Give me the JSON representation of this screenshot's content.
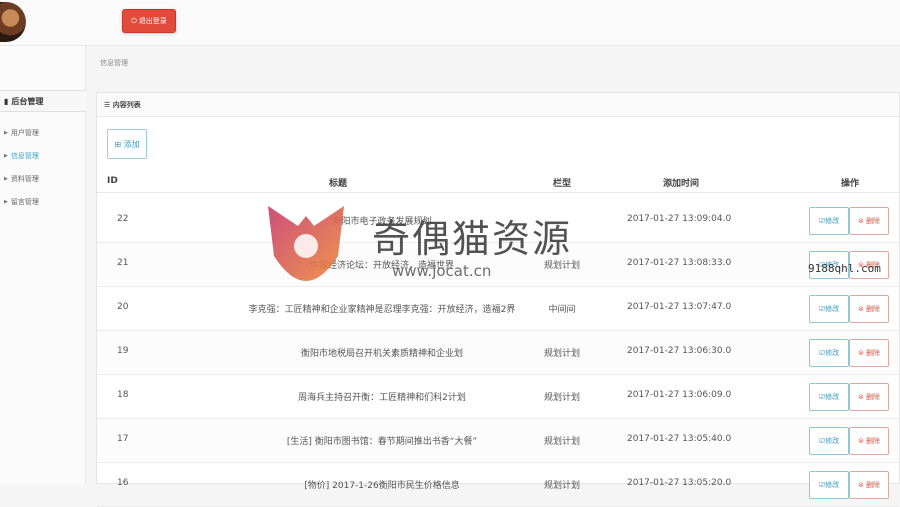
{
  "header": {
    "logout_label": "退出登录",
    "logout_icon": "power-icon"
  },
  "sidebar": {
    "title": "后台管理",
    "items": [
      {
        "label": "用户管理"
      },
      {
        "label": "信息管理",
        "active": true
      },
      {
        "label": "资料管理"
      },
      {
        "label": "留言管理"
      }
    ]
  },
  "breadcrumb": "信息管理",
  "panel": {
    "title": "☰ 内容列表",
    "add_label": "⊞ 添加"
  },
  "table": {
    "headers": [
      "ID",
      "标题",
      "栏型",
      "添加时间",
      "操作"
    ],
    "edit_label": "☑修改",
    "delete_label": "⊜ 删除",
    "rows": [
      {
        "id": "22",
        "title": "衡阳市电子政务发展规划",
        "col": "",
        "time": "2017-01-27 13:09:04.0"
      },
      {
        "id": "21",
        "title": "中国经济论坛：开放经济，造福世界",
        "col": "规划计划",
        "time": "2017-01-27 13:08:33.0"
      },
      {
        "id": "20",
        "title": "李克强：工匠精神和企业家精神是忍理李克强：开放经济，造福2界",
        "col": "中间间",
        "time": "2017-01-27 13:07:47.0"
      },
      {
        "id": "19",
        "title": "衡阳市地税局召开机关素质精神和企业划",
        "col": "规划计划",
        "time": "2017-01-27 13:06:30.0"
      },
      {
        "id": "18",
        "title": "周海兵主持召开衡：工匠精神和们科2计划",
        "col": "规划计划",
        "time": "2017-01-27 13:06:09.0"
      },
      {
        "id": "17",
        "title": "[生活] 衡阳市图书馆：春节期间推出书香“大餐”",
        "col": "规划计划",
        "time": "2017-01-27 13:05:40.0"
      },
      {
        "id": "16",
        "title": "[物价] 2017-1-26衡阳市民生价格信息",
        "col": "规划计划",
        "time": "2017-01-27 13:05:20.0"
      }
    ]
  },
  "watermark": {
    "text": "奇偶猫资源",
    "url": "www.jocat.cn",
    "side": "9188qhl.com"
  }
}
